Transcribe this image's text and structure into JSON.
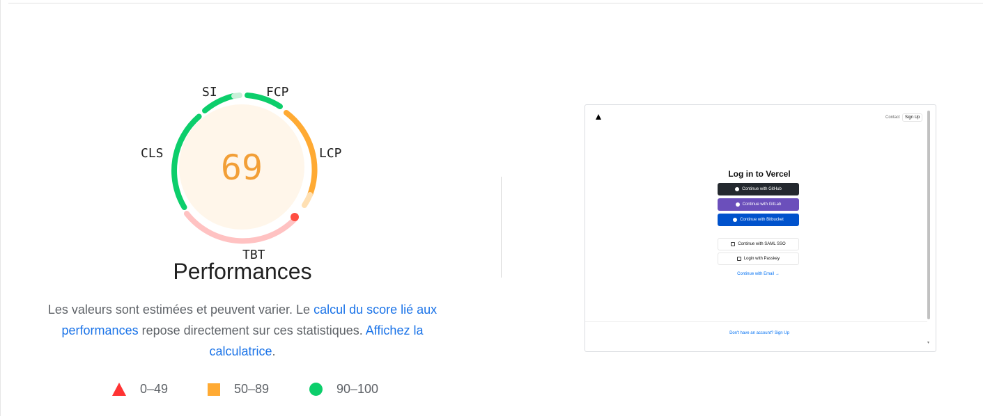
{
  "gauge": {
    "score": "69",
    "labels": {
      "si": "SI",
      "fcp": "FCP",
      "lcp": "LCP",
      "tbt": "TBT",
      "cls": "CLS"
    },
    "colors": {
      "good": "#0cce6b",
      "average": "#ffa400",
      "fail": "#ff4e42",
      "score_fill": "#fff6ea",
      "score_text": "#f29f37"
    }
  },
  "category_title": "Performances",
  "description": {
    "part1": "Les valeurs sont estimées et peuvent varier. Le ",
    "link1": "calcul du score lié aux performances",
    "part2": " repose directement sur ces statistiques. ",
    "link2": "Affichez la calculatrice",
    "part3": "."
  },
  "legend": [
    {
      "shape": "triangle",
      "range": "0–49",
      "color": "#ff3333"
    },
    {
      "shape": "square",
      "range": "50–89",
      "color": "#ffaa33"
    },
    {
      "shape": "circle",
      "range": "90–100",
      "color": "#0cce6b"
    }
  ],
  "screenshot": {
    "nav_contact": "Contact",
    "nav_signup": "Sign Up",
    "title": "Log in to Vercel",
    "btn_github": "Continue with GitHub",
    "btn_gitlab": "Continue with GitLab",
    "btn_bitbucket": "Continue with Bitbucket",
    "btn_saml": "Continue with SAML SSO",
    "btn_passkey": "Login with Passkey",
    "email_link": "Continue with Email →",
    "footer": "Don't have an account? Sign Up"
  }
}
